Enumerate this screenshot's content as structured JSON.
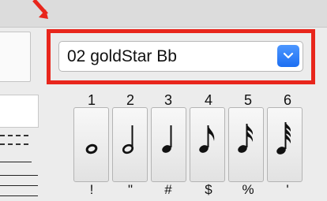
{
  "preset_select": {
    "value": "02 goldStar Bb"
  },
  "note_buttons": [
    {
      "number": "1",
      "shortcut": "!",
      "icon": "whole-note-icon"
    },
    {
      "number": "2",
      "shortcut": "\"",
      "icon": "half-note-icon"
    },
    {
      "number": "3",
      "shortcut": "#",
      "icon": "quarter-note-icon"
    },
    {
      "number": "4",
      "shortcut": "$",
      "icon": "eighth-note-icon"
    },
    {
      "number": "5",
      "shortcut": "%",
      "icon": "sixteenth-note-icon"
    },
    {
      "number": "6",
      "shortcut": "'",
      "icon": "thirty-second-note-icon"
    }
  ],
  "colors": {
    "highlight": "#e8261c",
    "select_arrow": "#2a7bf7"
  }
}
